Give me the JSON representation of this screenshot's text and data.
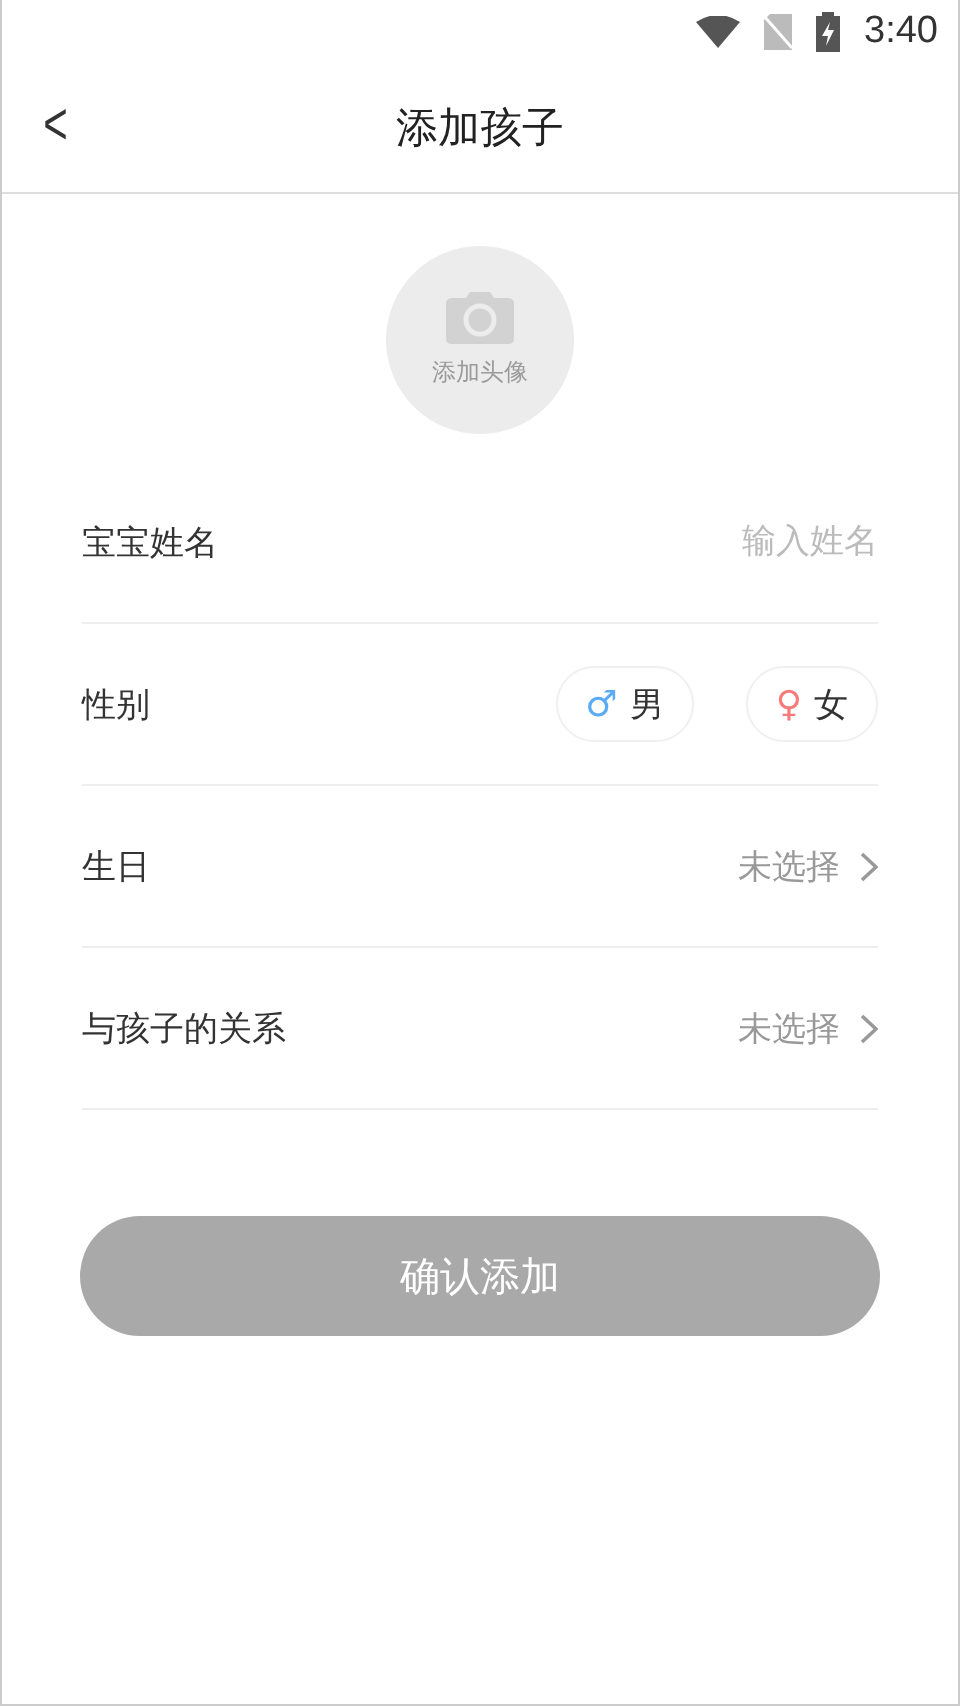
{
  "status_bar": {
    "time": "3:40"
  },
  "header": {
    "back": "<",
    "title": "添加孩子"
  },
  "avatar": {
    "label": "添加头像"
  },
  "rows": [
    {
      "kind": "input",
      "label": "宝宝姓名",
      "placeholder": "输入姓名"
    },
    {
      "kind": "gender",
      "label": "性别",
      "options": [
        {
          "symbol": "♂",
          "label": "男",
          "color": "#5aabf5",
          "selected": false
        },
        {
          "symbol": "♀",
          "label": "女",
          "color": "#f77b7b",
          "selected": false
        }
      ]
    },
    {
      "kind": "select",
      "label": "生日",
      "value": "未选择"
    },
    {
      "kind": "select",
      "label": "与孩子的关系",
      "value": "未选择"
    }
  ],
  "submit": {
    "label": "确认添加",
    "disabled": true
  }
}
